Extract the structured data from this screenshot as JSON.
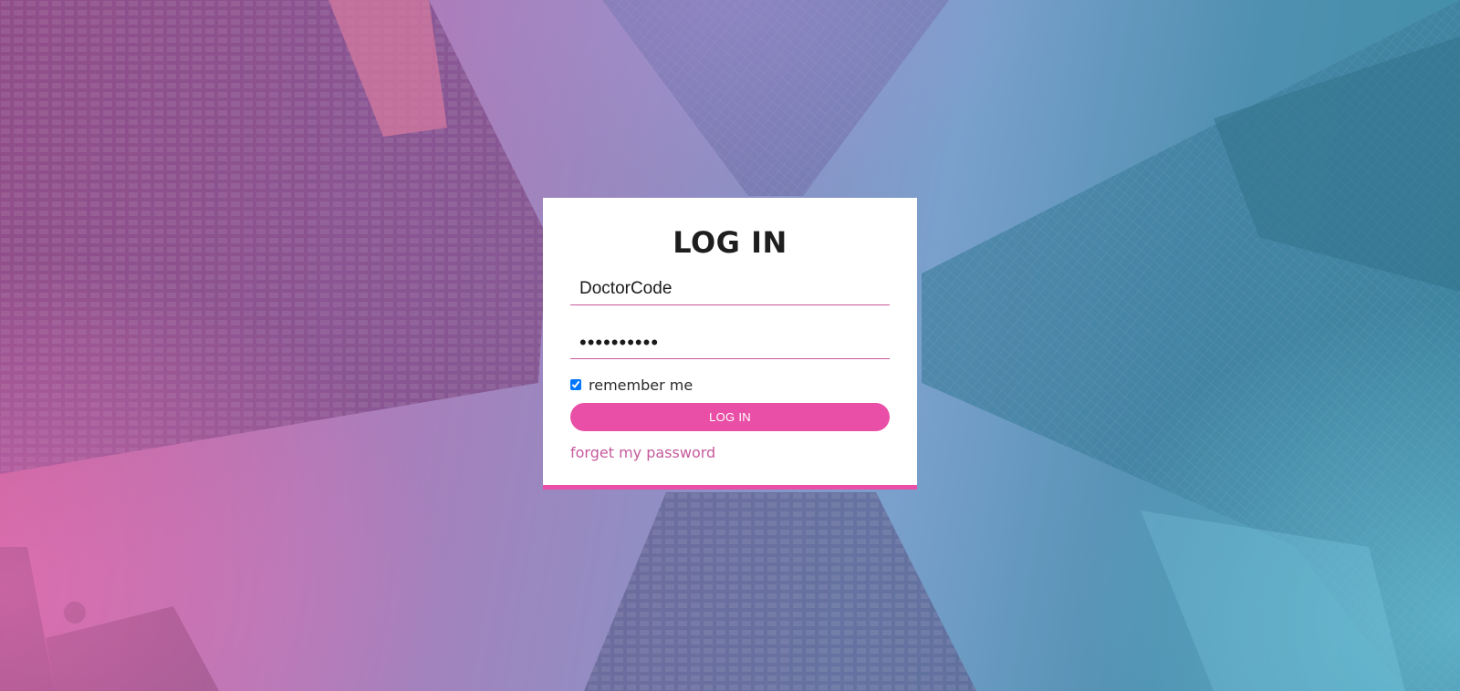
{
  "login": {
    "title": "LOG IN",
    "username_value": "DoctorCode",
    "password_value": "••••••••••",
    "remember_checked": true,
    "remember_label": "remember me",
    "button_label": "LOG IN",
    "forgot_link": "forget my password"
  },
  "colors": {
    "accent": "#e94fa6",
    "link": "#c55a9c",
    "underline": "#c9579b"
  }
}
